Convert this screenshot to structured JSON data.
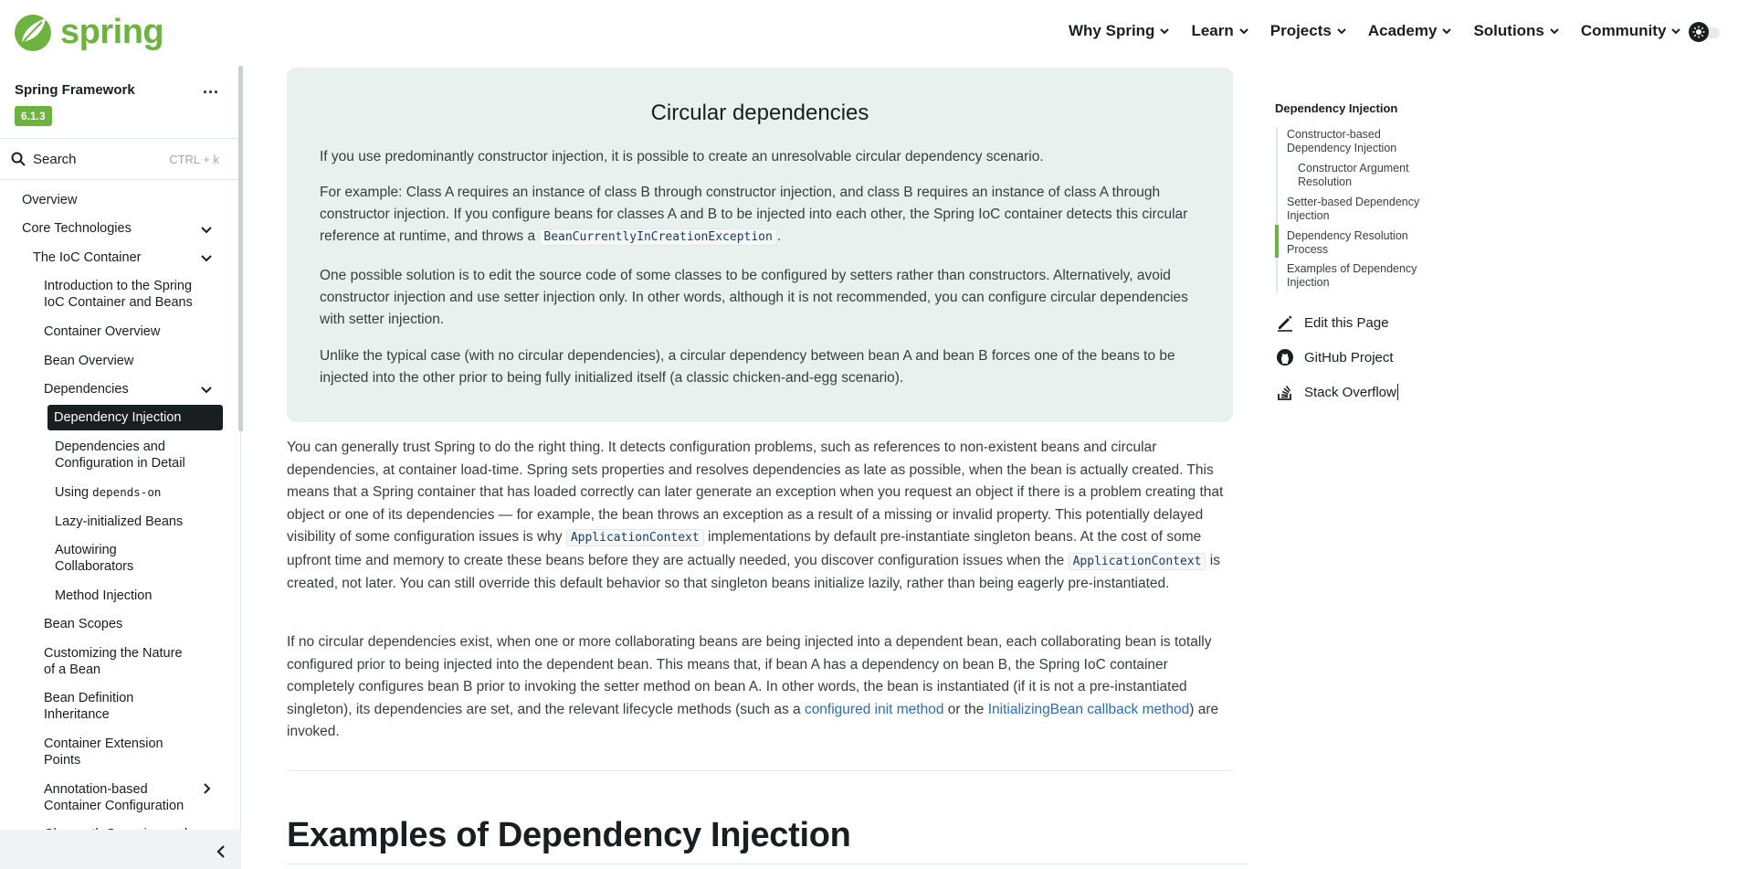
{
  "header": {
    "logo_text": "spring",
    "nav": [
      {
        "label": "Why Spring"
      },
      {
        "label": "Learn"
      },
      {
        "label": "Projects"
      },
      {
        "label": "Academy"
      },
      {
        "label": "Solutions"
      },
      {
        "label": "Community"
      }
    ]
  },
  "sidebar": {
    "project_title": "Spring Framework",
    "menu_label": "...",
    "version": "6.1.3",
    "search_label": "Search",
    "search_shortcut": "CTRL + k",
    "items": [
      {
        "label": "Overview"
      },
      {
        "label": "Core Technologies"
      },
      {
        "label": "The IoC Container"
      },
      {
        "label": "Introduction to the Spring IoC Container and Beans"
      },
      {
        "label": "Container Overview"
      },
      {
        "label": "Bean Overview"
      },
      {
        "label": "Dependencies"
      },
      {
        "label": "Dependency Injection"
      },
      {
        "label": "Dependencies and Configuration in Detail"
      },
      {
        "label_prefix": "Using ",
        "label_code": "depends-on"
      },
      {
        "label": "Lazy-initialized Beans"
      },
      {
        "label": "Autowiring Collaborators"
      },
      {
        "label": "Method Injection"
      },
      {
        "label": "Bean Scopes"
      },
      {
        "label": "Customizing the Nature of a Bean"
      },
      {
        "label": "Bean Definition Inheritance"
      },
      {
        "label": "Container Extension Points"
      },
      {
        "label": "Annotation-based Container Configuration"
      },
      {
        "label": "Classpath Scanning and"
      }
    ]
  },
  "callout": {
    "title": "Circular dependencies",
    "p1": "If you use predominantly constructor injection, it is possible to create an unresolvable circular dependency scenario.",
    "p2_a": "For example: Class A requires an instance of class B through constructor injection, and class B requires an instance of class A through constructor injection. If you configure beans for classes A and B to be injected into each other, the Spring IoC container detects this circular reference at runtime, and throws a ",
    "p2_code": "BeanCurrentlyInCreationException",
    "p2_b": ".",
    "p3": "One possible solution is to edit the source code of some classes to be configured by setters rather than constructors. Alternatively, avoid constructor injection and use setter injection only. In other words, although it is not recommended, you can configure circular dependencies with setter injection.",
    "p4": "Unlike the typical case (with no circular dependencies), a circular dependency between bean A and bean B forces one of the beans to be injected into the other prior to being fully initialized itself (a classic chicken-and-egg scenario)."
  },
  "body": {
    "p1_a": "You can generally trust Spring to do the right thing. It detects configuration problems, such as references to non-existent beans and circular dependencies, at container load-time. Spring sets properties and resolves dependencies as late as possible, when the bean is actually created. This means that a Spring container that has loaded correctly can later generate an exception when you request an object if there is a problem creating that object or one of its dependencies — for example, the bean throws an exception as a result of a missing or invalid property. This potentially delayed visibility of some configuration issues is why ",
    "p1_code1": "ApplicationContext",
    "p1_b": " implementations by default pre-instantiate singleton beans. At the cost of some upfront time and memory to create these beans before they are actually needed, you discover configuration issues when the ",
    "p1_code2": "ApplicationContext",
    "p1_c": " is created, not later. You can still override this default behavior so that singleton beans initialize lazily, rather than being eagerly pre-instantiated.",
    "p2_a": "If no circular dependencies exist, when one or more collaborating beans are being injected into a dependent bean, each collaborating bean is totally configured prior to being injected into the dependent bean. This means that, if bean A has a dependency on bean B, the Spring IoC container completely configures bean B prior to invoking the setter method on bean A. In other words, the bean is instantiated (if it is not a pre-instantiated singleton), its dependencies are set, and the relevant lifecycle methods (such as a ",
    "p2_link1": "configured init method",
    "p2_b": " or the ",
    "p2_link2": "InitializingBean callback method",
    "p2_c": ") are invoked.",
    "heading": "Examples of Dependency Injection"
  },
  "toc": {
    "title": "Dependency Injection",
    "items": [
      {
        "label": "Constructor-based Dependency Injection"
      },
      {
        "label": "Constructor Argument Resolution"
      },
      {
        "label": "Setter-based Dependency Injection"
      },
      {
        "label": "Dependency Resolution Process"
      },
      {
        "label": "Examples of Dependency Injection"
      }
    ],
    "actions": [
      {
        "label": "Edit this Page"
      },
      {
        "label": "GitHub Project"
      },
      {
        "label": "Stack Overflow"
      }
    ]
  },
  "colors": {
    "brand": "#6db33f",
    "callout_bg": "#e8f1ee",
    "link": "#2e6db4",
    "active_item_bg": "#191e1e"
  }
}
